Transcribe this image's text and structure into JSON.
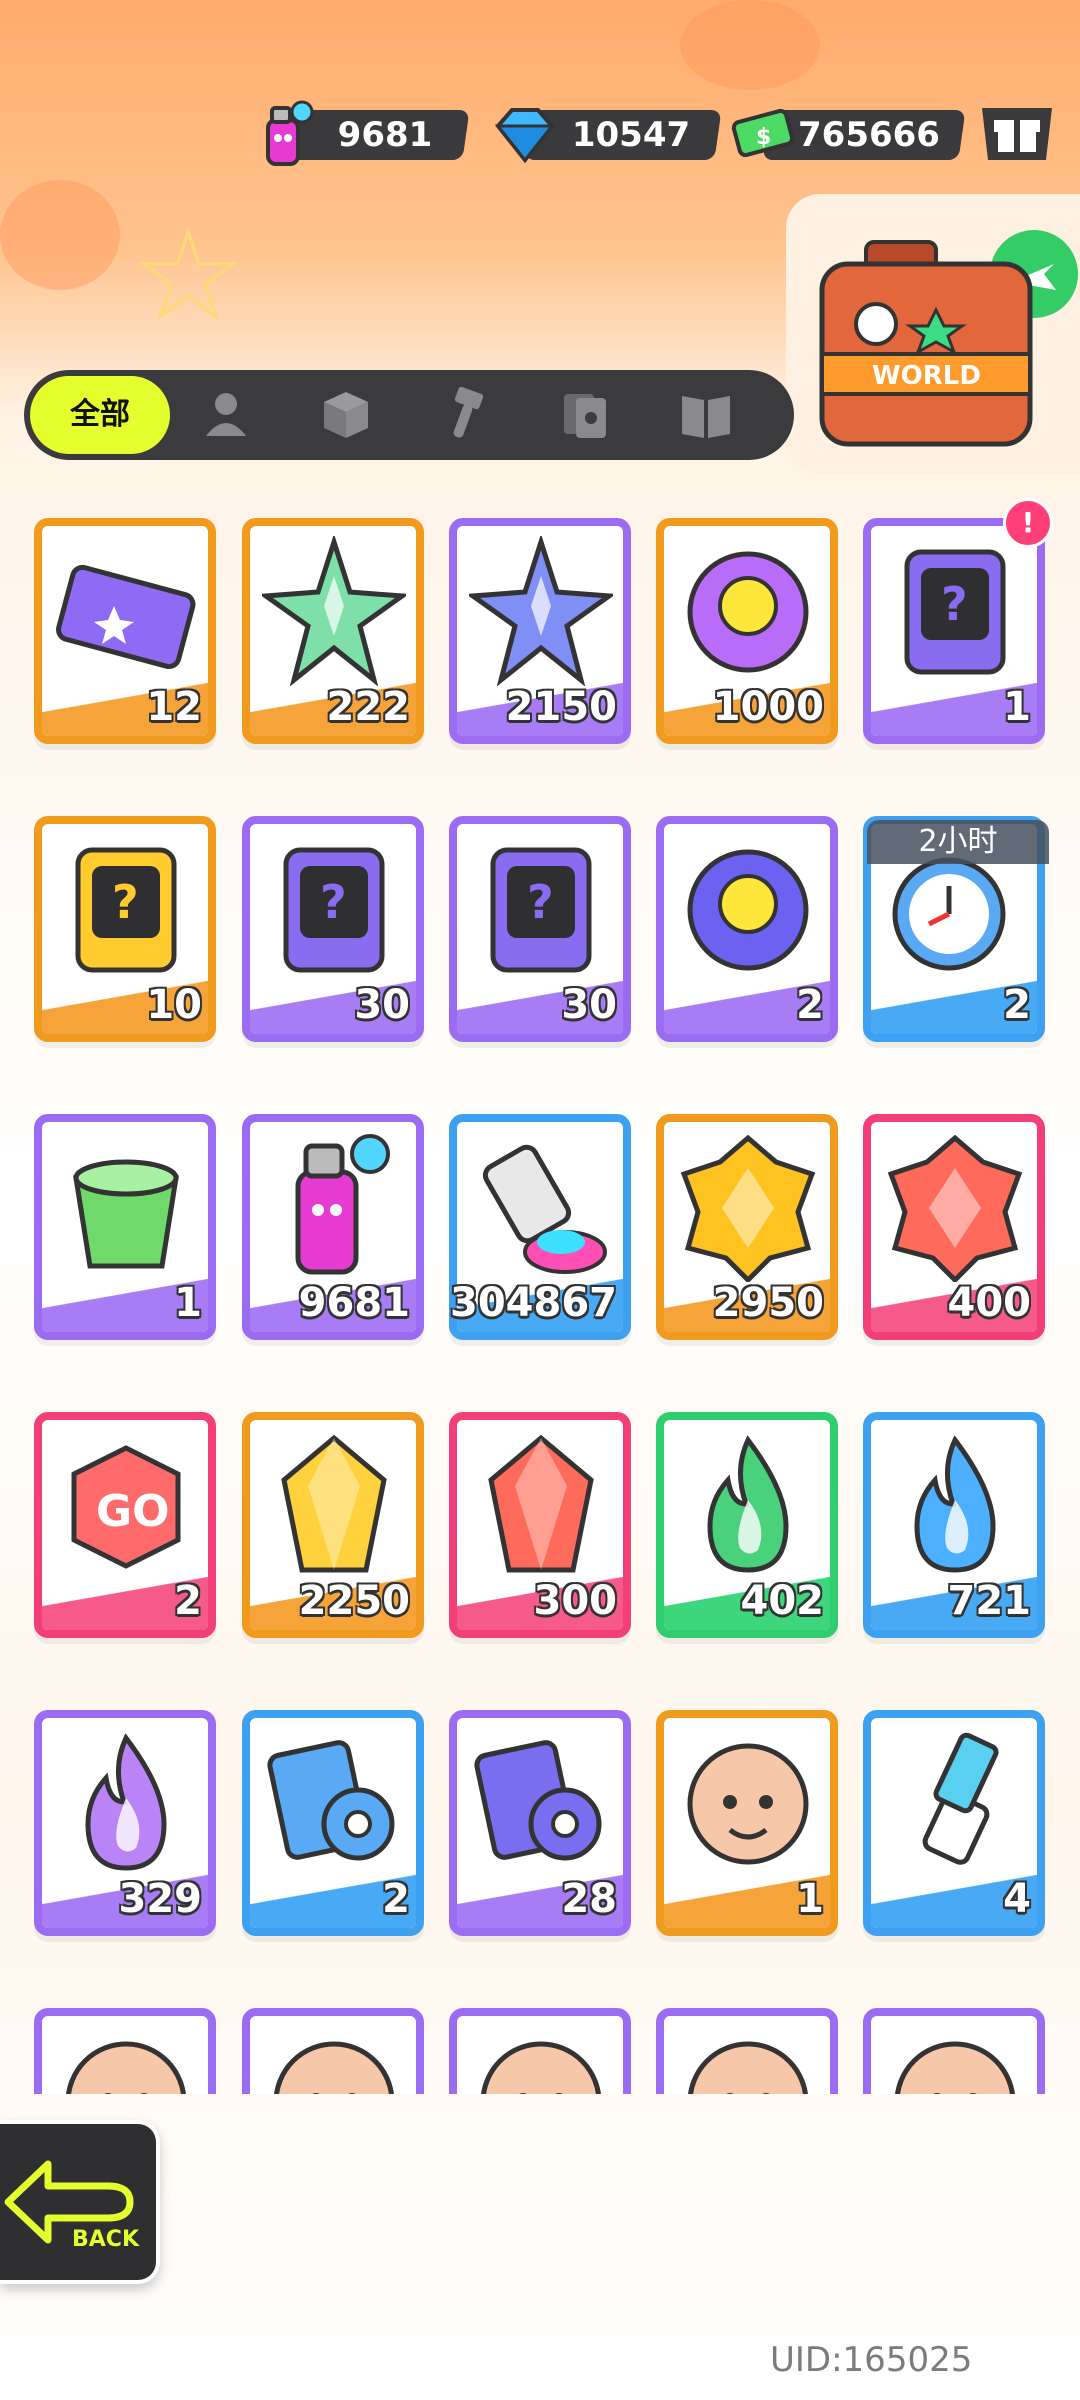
{
  "header": {
    "currencies": [
      {
        "icon": "spray-can-icon",
        "value": "9681"
      },
      {
        "icon": "diamond-icon",
        "value": "10547"
      },
      {
        "icon": "cash-icon",
        "value": "765666"
      }
    ],
    "shop_icon": "gift-box-icon",
    "travel_case_label": "WORLD"
  },
  "tabs": {
    "all_label": "全部",
    "icons": [
      "person-icon",
      "box-icon",
      "hammer-icon",
      "cards-icon",
      "book-icon"
    ]
  },
  "inventory": [
    {
      "name": "ticket",
      "count": "12",
      "border": "#f09a1e",
      "wave": "#f6a33a"
    },
    {
      "name": "rainbow-star",
      "count": "222",
      "border": "#f09a1e",
      "wave": "#f6a33a"
    },
    {
      "name": "blue-star",
      "count": "2150",
      "border": "#9b6cf2",
      "wave": "#a77cf5"
    },
    {
      "name": "cool-badge",
      "count": "1000",
      "border": "#f09a1e",
      "wave": "#f6a33a"
    },
    {
      "name": "travel-card",
      "count": "1",
      "border": "#9b6cf2",
      "wave": "#a77cf5",
      "badge": "!"
    },
    {
      "name": "mystery-deity-gold",
      "count": "10",
      "border": "#f09a1e",
      "wave": "#f6a33a"
    },
    {
      "name": "mystery-deity-purple",
      "count": "30",
      "border": "#9b6cf2",
      "wave": "#a77cf5"
    },
    {
      "name": "mystery-travel-card",
      "count": "30",
      "border": "#9b6cf2",
      "wave": "#a77cf5"
    },
    {
      "name": "jelly-orb",
      "count": "2",
      "border": "#9b6cf2",
      "wave": "#a77cf5"
    },
    {
      "name": "alarm-clock",
      "count": "2",
      "border": "#3ea0f0",
      "wave": "#48aaf5",
      "timer": "2小时"
    },
    {
      "name": "green-cup",
      "count": "1",
      "border": "#9b6cf2",
      "wave": "#a77cf5"
    },
    {
      "name": "spray-can",
      "count": "9681",
      "border": "#9b6cf2",
      "wave": "#a77cf5"
    },
    {
      "name": "paint-tube",
      "count": "304867",
      "border": "#3ea0f0",
      "wave": "#48aaf5"
    },
    {
      "name": "gold-crystal",
      "count": "2950",
      "border": "#f09a1e",
      "wave": "#f6a33a"
    },
    {
      "name": "red-crystal",
      "count": "400",
      "border": "#f23f7a",
      "wave": "#f65a8a"
    },
    {
      "name": "go-dice",
      "count": "2",
      "border": "#f23f7a",
      "wave": "#f65a8a"
    },
    {
      "name": "gold-gem",
      "count": "2250",
      "border": "#f09a1e",
      "wave": "#f6a33a"
    },
    {
      "name": "red-gem",
      "count": "300",
      "border": "#f23f7a",
      "wave": "#f65a8a"
    },
    {
      "name": "green-flame",
      "count": "402",
      "border": "#2fcf6f",
      "wave": "#3ed67c"
    },
    {
      "name": "blue-flame",
      "count": "721",
      "border": "#3ea0f0",
      "wave": "#48aaf5"
    },
    {
      "name": "purple-flame",
      "count": "329",
      "border": "#9b6cf2",
      "wave": "#a77cf5"
    },
    {
      "name": "blue-tape-cards",
      "count": "2",
      "border": "#3ea0f0",
      "wave": "#48aaf5"
    },
    {
      "name": "purple-tape-cards",
      "count": "28",
      "border": "#9b6cf2",
      "wave": "#a77cf5"
    },
    {
      "name": "deity-avatar",
      "count": "1",
      "border": "#f09a1e",
      "wave": "#f6a33a"
    },
    {
      "name": "usb-key",
      "count": "4",
      "border": "#3ea0f0",
      "wave": "#48aaf5"
    },
    {
      "name": "character-a",
      "count": "",
      "border": "#9b6cf2",
      "wave": "#a77cf5"
    },
    {
      "name": "character-b",
      "count": "",
      "border": "#9b6cf2",
      "wave": "#a77cf5"
    },
    {
      "name": "character-c",
      "count": "",
      "border": "#9b6cf2",
      "wave": "#a77cf5"
    },
    {
      "name": "character-d",
      "count": "",
      "border": "#9b6cf2",
      "wave": "#a77cf5"
    },
    {
      "name": "character-e",
      "count": "",
      "border": "#9b6cf2",
      "wave": "#a77cf5"
    }
  ],
  "footer": {
    "back_label": "BACK",
    "uid": "UID:165025"
  }
}
